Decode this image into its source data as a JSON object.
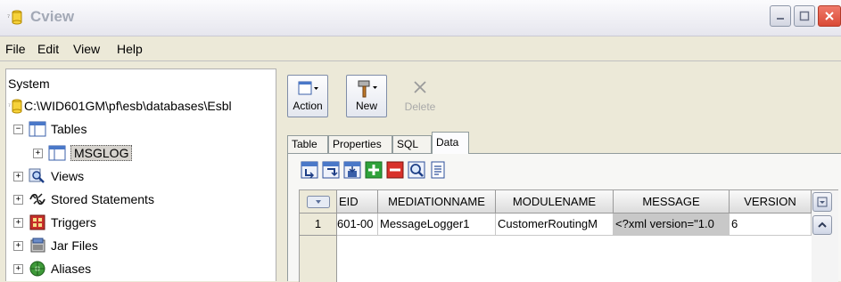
{
  "window": {
    "title": "Cview"
  },
  "menu": [
    "File",
    "Edit",
    "View",
    "Help"
  ],
  "tree": {
    "root": "System",
    "database": "C:\\WID601GM\\pf\\esb\\databases\\Esbl",
    "tables": "Tables",
    "table_selected": "MSGLOG",
    "views": "Views",
    "stored": "Stored Statements",
    "triggers": "Triggers",
    "jar": "Jar Files",
    "aliases": "Aliases"
  },
  "toolbar": {
    "action": "Action",
    "new": "New",
    "delete": "Delete"
  },
  "tabs": [
    "Table",
    "Properties",
    "SQL",
    "Data"
  ],
  "active_tab": "Data",
  "grid": {
    "columns": [
      "EID",
      "MEDIATIONNAME",
      "MODULENAME",
      "MESSAGE",
      "VERSION"
    ],
    "rows": [
      {
        "num": "1",
        "cells": [
          "601-00",
          "MessageLogger1",
          "CustomerRoutingM",
          "<?xml version=\"1.0",
          "6"
        ]
      }
    ]
  },
  "colors": {
    "title_text": "#a3a9b6",
    "close_button": "#d94a36",
    "selected_cell": "#c8c8c8"
  },
  "icons": [
    "app-icon",
    "table-icon",
    "views-icon",
    "stored-statements-icon",
    "triggers-icon",
    "jar-files-icon",
    "aliases-icon",
    "refresh-icon",
    "plus-icon",
    "minus-icon",
    "search-icon",
    "notes-icon"
  ]
}
